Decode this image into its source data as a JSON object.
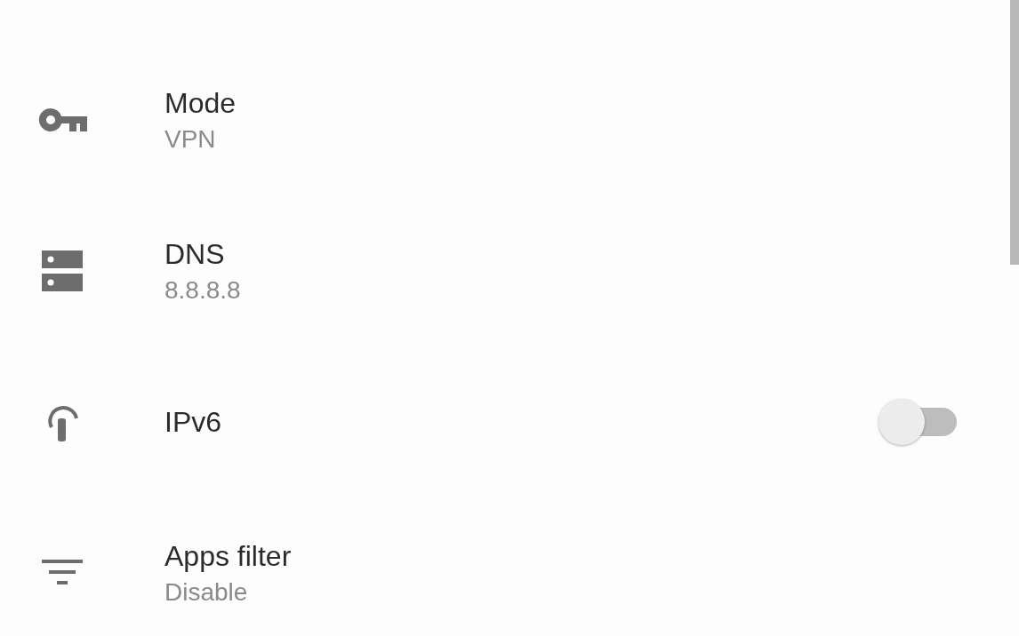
{
  "settings": [
    {
      "kind": "value",
      "title": "Mode",
      "value": "VPN"
    },
    {
      "kind": "value",
      "title": "DNS",
      "value": "8.8.8.8"
    },
    {
      "kind": "switch",
      "title": "IPv6",
      "on": false
    },
    {
      "kind": "value",
      "title": "Apps filter",
      "value": "Disable"
    }
  ]
}
